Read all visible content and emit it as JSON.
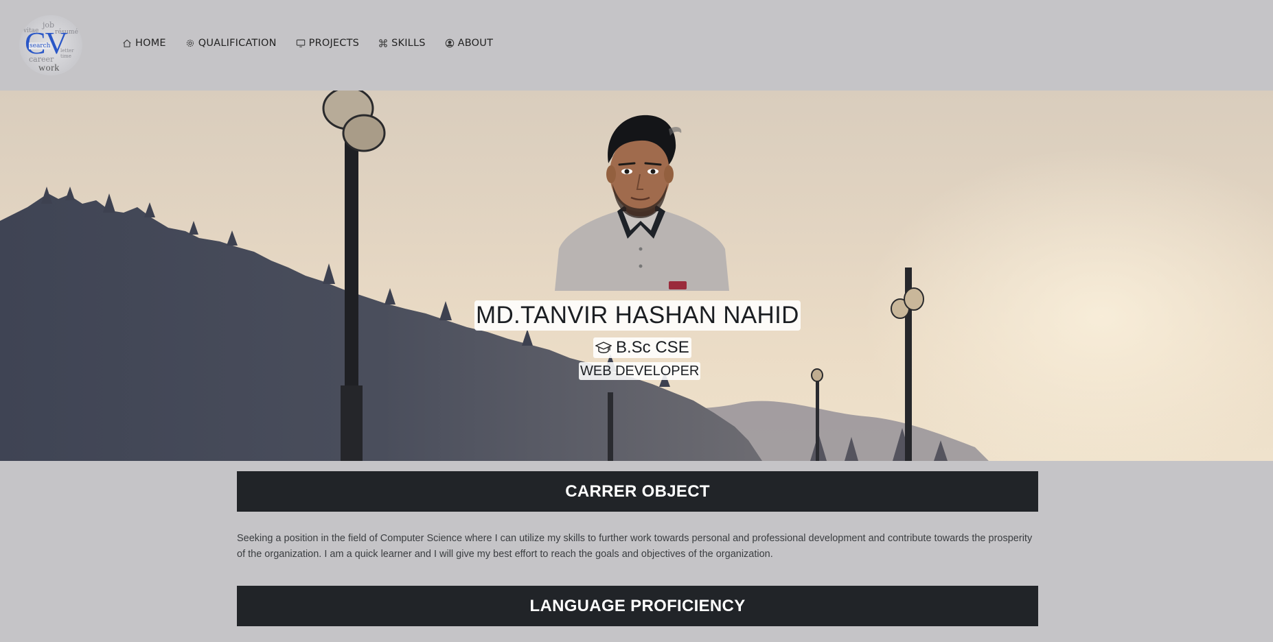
{
  "logo": {
    "main_text": "CV",
    "sub_text": "work",
    "cloud_words": [
      "job",
      "vitae",
      "résumé",
      "search",
      "career",
      "letter",
      "time"
    ]
  },
  "nav": {
    "items": [
      {
        "label": "HOME",
        "icon": "home-icon"
      },
      {
        "label": "QUALIFICATION",
        "icon": "gear-icon"
      },
      {
        "label": "PROJECTS",
        "icon": "monitor-icon"
      },
      {
        "label": "SKILLS",
        "icon": "command-icon"
      },
      {
        "label": "ABOUT",
        "icon": "user-circle-icon"
      }
    ]
  },
  "hero": {
    "name": "MD.TANVIR HASHAN NAHID",
    "degree": "B.Sc CSE",
    "degree_icon": "graduation-cap-icon",
    "role": "WEB DEVELOPER"
  },
  "sections": {
    "career": {
      "title": "CARRER OBJECT",
      "text": "Seeking a position in the field of Computer Science where I can utilize my skills to further work towards personal and professional development and contribute towards the prosperity of the organization. I am a quick learner and I will give my best effort to reach the goals and objectives of the organization."
    },
    "language": {
      "title": "LANGUAGE PROFICIENCY"
    }
  },
  "colors": {
    "page_bg": "#c5c4c7",
    "section_header_bg": "#212428",
    "logo_accent": "#2a57c7"
  }
}
